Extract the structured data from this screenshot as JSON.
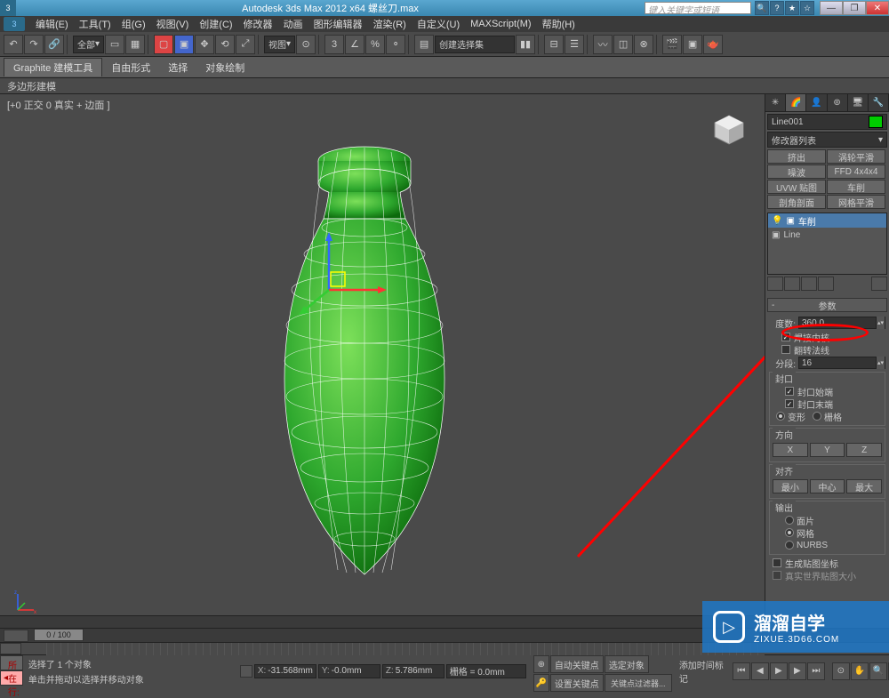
{
  "titlebar": {
    "app_title": "Autodesk 3ds Max 2012 x64    螺丝刀.max",
    "search_placeholder": "键入关键字或短语"
  },
  "menubar": {
    "items": [
      "编辑(E)",
      "工具(T)",
      "组(G)",
      "视图(V)",
      "创建(C)",
      "修改器",
      "动画",
      "图形编辑器",
      "渲染(R)",
      "自定义(U)",
      "MAXScript(M)",
      "帮助(H)"
    ]
  },
  "toolbar": {
    "selection_set_label": "全部",
    "view_label": "视图",
    "create_selection_label": "创建选择集"
  },
  "ribbon": {
    "tabs": [
      "Graphite 建模工具",
      "自由形式",
      "选择",
      "对象绘制"
    ],
    "sub_label": "多边形建模"
  },
  "viewport": {
    "label": "[+0 正交 0 真实 + 边面 ]"
  },
  "cmd_panel": {
    "object_name": "Line001",
    "modifier_list_label": "修改器列表",
    "mod_buttons": [
      "挤出",
      "涡轮平滑",
      "噪波",
      "FFD 4x4x4",
      "UVW 贴图",
      "车削",
      "剖角剖面",
      "网格平滑"
    ],
    "stack": [
      {
        "icon": "💡",
        "label": "车削",
        "active": true
      },
      {
        "icon": "■",
        "label": "Line",
        "active": false
      }
    ],
    "params_header": "参数",
    "degrees_label": "度数:",
    "degrees_value": "360.0",
    "weld_core_label": "焊接内核",
    "flip_normals_label": "翻转法线",
    "segments_label": "分段:",
    "segments_value": "16",
    "capping_group": "封口",
    "cap_start_label": "封口始端",
    "cap_end_label": "封口末端",
    "morph_label": "变形",
    "grid_label": "栅格",
    "direction_group": "方向",
    "direction_buttons": [
      "X",
      "Y",
      "Z"
    ],
    "align_group": "对齐",
    "align_buttons": [
      "最小",
      "中心",
      "最大"
    ],
    "output_group": "输出",
    "output_patch": "面片",
    "output_mesh": "网格",
    "output_nurbs": "NURBS",
    "gen_mapping_label": "生成贴图坐标",
    "real_world_label": "真实世界贴图大小"
  },
  "timeline": {
    "slider_label": "0 / 100"
  },
  "status": {
    "now_label": "所在行:",
    "selection_info": "选择了 1 个对象",
    "hint": "单击并拖动以选择并移动对象",
    "x_label": "X:",
    "x_val": "-31.568mm",
    "y_label": "Y:",
    "y_val": "-0.0mm",
    "z_label": "Z:",
    "z_val": "5.786mm",
    "grid_label": "栅格 = 0.0mm",
    "auto_key_label": "自动关键点",
    "set_key_label": "设置关键点",
    "selected_label": "选定对象",
    "add_time_tag": "添加时间标记",
    "key_filters": "关键点过滤器..."
  },
  "watermark": {
    "brand": "溜溜自学",
    "url": "ZIXUE.3D66.COM"
  }
}
